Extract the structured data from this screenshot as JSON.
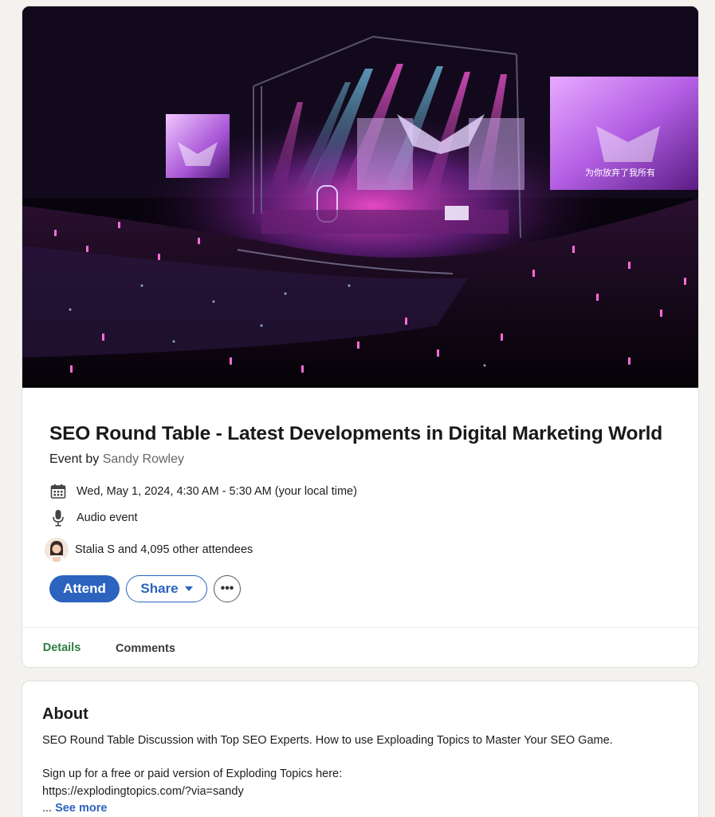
{
  "event": {
    "title": "SEO Round Table - Latest Developments in Digital Marketing World",
    "organizer_prefix": "Event by",
    "organizer_name": "Sandy Rowley",
    "datetime": "Wed, May 1, 2024, 4:30 AM - 5:30 AM (your local time)",
    "type": "Audio event",
    "attendees": "Stalia S and 4,095 other attendees",
    "banner_screen_text": "为你放弃了我所有"
  },
  "actions": {
    "attend_label": "Attend",
    "share_label": "Share",
    "more_label": "•••"
  },
  "tabs": [
    {
      "label": "Details",
      "active": true
    },
    {
      "label": "Comments",
      "active": false
    }
  ],
  "about": {
    "title": "About",
    "description": "SEO Round Table Discussion with Top SEO Experts. How to use Exploading Topics to Master Your SEO Game.",
    "signup_line": "Sign up for a free or paid version of Exploding Topics here:",
    "link": "https://explodingtopics.com/?via=sandy",
    "ellipsis": "...",
    "see_more": "See more"
  },
  "colors": {
    "primary": "#2b63be",
    "active_tab": "#2e7d46",
    "page_bg": "#f3f2ef"
  },
  "icons": [
    "calendar-icon",
    "microphone-icon",
    "caret-down-icon",
    "more-icon"
  ]
}
